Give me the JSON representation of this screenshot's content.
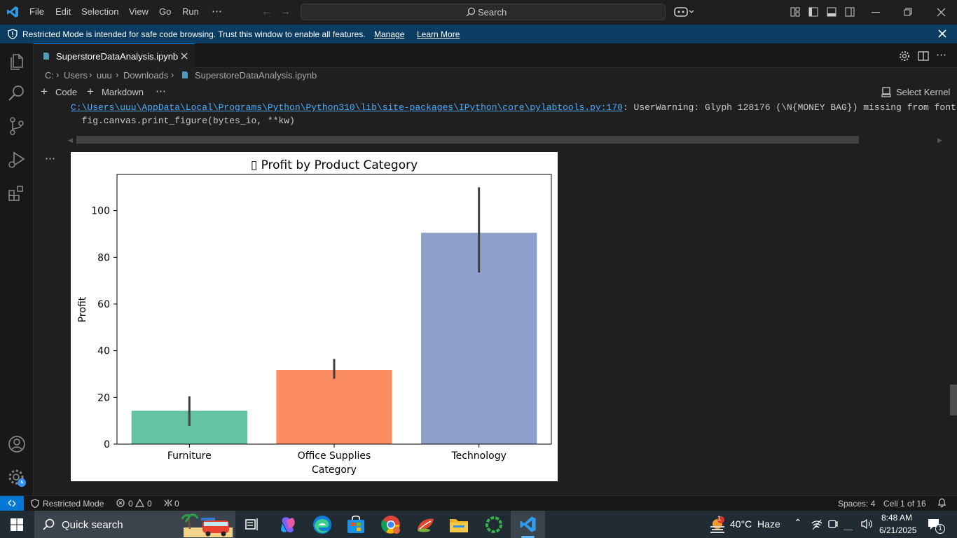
{
  "menu": [
    "File",
    "Edit",
    "Selection",
    "View",
    "Go",
    "Run",
    "⋯"
  ],
  "search": {
    "label": "Search"
  },
  "banner": {
    "text": "Restricted Mode is intended for safe code browsing. Trust this window to enable all features.",
    "manage": "Manage",
    "learn_more": "Learn More"
  },
  "tab": {
    "label": "SuperstoreDataAnalysis.ipynb"
  },
  "breadcrumb": [
    "C:",
    "Users",
    "uuu",
    "Downloads",
    "SuperstoreDataAnalysis.ipynb"
  ],
  "toolbar": {
    "code": "Code",
    "markdown": "Markdown",
    "more": "⋯",
    "kernel": "Select Kernel"
  },
  "output": {
    "warning_path": "C:\\Users\\uuu\\AppData\\Local\\Programs\\Python\\Python310\\lib\\site-packages\\IPython\\core\\pylabtools.py:170",
    "warning_text": ": UserWarning: Glyph 128176 (\\N{MONEY BAG}) missing from font",
    "warning_line2": "  fig.canvas.print_figure(bytes_io, **kw)",
    "cell_more": "⋯"
  },
  "chart_data": {
    "type": "bar",
    "title": "▯ Profit by Product Category",
    "xlabel": "Category",
    "ylabel": "Profit",
    "categories": [
      "Furniture",
      "Office Supplies",
      "Technology"
    ],
    "values": [
      14.3,
      31.8,
      90.5
    ],
    "error_low": [
      7.8,
      28.0,
      73.5
    ],
    "error_high": [
      20.5,
      36.5,
      110.0
    ],
    "colors": [
      "#66c2a5",
      "#fc8d62",
      "#8da0cb"
    ],
    "yticks": [
      0,
      20,
      40,
      60,
      80,
      100
    ],
    "ylim": [
      0,
      115.5
    ]
  },
  "status": {
    "mode": "Restricted Mode",
    "errors": "0",
    "warnings": "0",
    "ports": "0",
    "spaces": "Spaces: 4",
    "cell": "Cell 1 of 16"
  },
  "taskbar": {
    "search": "Quick search",
    "weather": "40°C  Haze",
    "time": "8:48 AM",
    "date": "6/21/2025",
    "weather_badge": "1",
    "notif_badge": "1"
  },
  "colors": {
    "accent": "#0078d4",
    "banner": "#0b3d63",
    "link": "#4daafc"
  }
}
